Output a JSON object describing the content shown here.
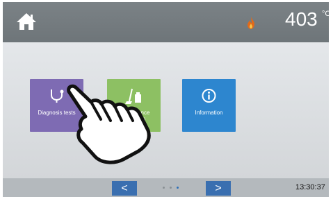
{
  "header": {
    "temperature_value": "403",
    "temperature_unit": "°C",
    "home_icon": "home-icon",
    "flame_icon": "flame-icon"
  },
  "tiles": [
    {
      "label": "Diagnosis tests",
      "icon": "stethoscope-icon",
      "color": "#7e6bb3"
    },
    {
      "label": "Maintenance programs",
      "icon": "cleaning-icon",
      "color": "#8dc063"
    },
    {
      "label": "Information",
      "icon": "info-icon",
      "color": "#2d86cf"
    }
  ],
  "footer": {
    "prev_label": "<",
    "next_label": ">",
    "page_count": 3,
    "current_page": 3,
    "time": "13:30:37"
  }
}
